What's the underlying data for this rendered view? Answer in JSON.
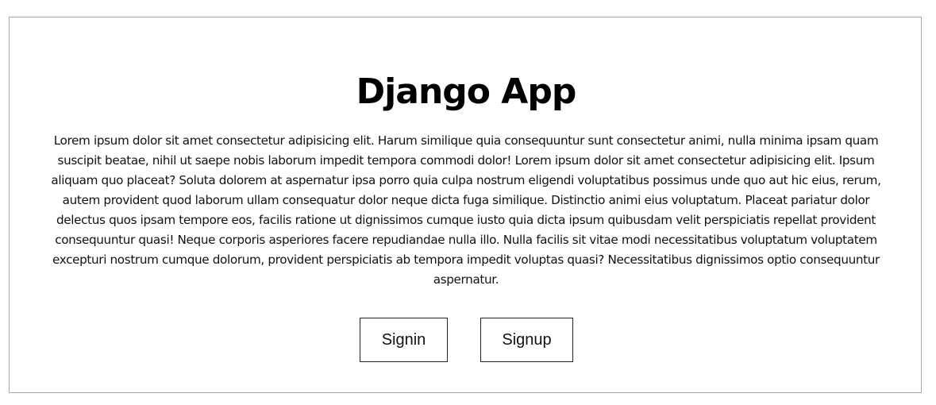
{
  "app": {
    "title": "Django App",
    "description": "Lorem ipsum dolor sit amet consectetur adipisicing elit. Harum similique quia consequuntur sunt consectetur animi, nulla minima ipsam quam suscipit beatae, nihil ut saepe nobis laborum impedit tempora commodi dolor! Lorem ipsum dolor sit amet consectetur adipisicing elit. Ipsum aliquam quo placeat? Soluta dolorem at aspernatur ipsa porro quia culpa nostrum eligendi voluptatibus possimus unde quo aut hic eius, rerum, autem provident quod laborum ullam consequatur dolor neque dicta fuga similique. Distinctio animi eius voluptatum. Placeat pariatur dolor delectus quos ipsam tempore eos, facilis ratione ut dignissimos cumque iusto quia dicta ipsum quibusdam velit perspiciatis repellat provident consequuntur quasi! Neque corporis asperiores facere repudiandae nulla illo. Nulla facilis sit vitae modi necessitatibus voluptatum voluptatem excepturi nostrum cumque dolorum, provident perspiciatis ab tempora impedit voluptas quasi? Necessitatibus dignissimos optio consequuntur aspernatur."
  },
  "actions": {
    "signin_label": "Signin",
    "signup_label": "Signup"
  }
}
